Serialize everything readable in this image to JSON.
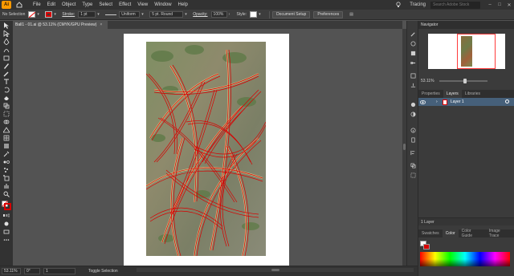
{
  "app": {
    "logo_text": "Ai",
    "workspace": "Tracing",
    "search_placeholder": "Search Adobe Stock"
  },
  "menu": [
    "File",
    "Edit",
    "Object",
    "Type",
    "Select",
    "Effect",
    "View",
    "Window",
    "Help"
  ],
  "controlbar": {
    "selection_label": "No Selection",
    "stroke_label": "Stroke:",
    "stroke_weight": "1 pt",
    "profile": "Uniform",
    "brush": "5 pt. Round",
    "opacity_label": "Opacity:",
    "opacity": "100%",
    "style_label": "Style:",
    "doc_setup": "Document Setup",
    "preferences": "Preferences"
  },
  "document": {
    "tab_title": "Ball1 - 01.ai @ 53.11% (CMYK/GPU Preview)",
    "close": "×"
  },
  "statusbar": {
    "zoom": "53.11%",
    "rotation": "0°",
    "artboard": "1",
    "tool": "Toggle Selection"
  },
  "navigator": {
    "title": "Navigator",
    "zoom": "53.11%"
  },
  "layers": {
    "tabs": [
      "Properties",
      "Layers",
      "Libraries"
    ],
    "active_tab": "Layers",
    "items": [
      {
        "name": "Layer 1"
      }
    ],
    "footer": "1 Layer"
  },
  "color_panel": {
    "tabs": [
      "Swatches",
      "Color",
      "Color Guide",
      "Image Trace"
    ],
    "active_tab": "Color",
    "fill_color": "#ffffff",
    "stroke_color": "#d80000"
  },
  "colors": {
    "accent": "#ff9a00",
    "selection": "#46607a",
    "trace_stroke": "#d80000"
  }
}
